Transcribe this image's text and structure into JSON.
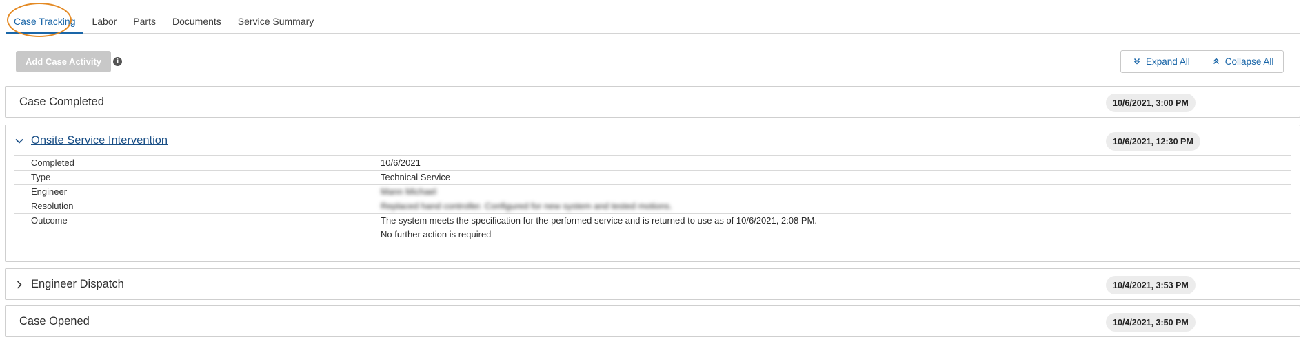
{
  "tabs": [
    {
      "label": "Case Tracking",
      "active": true
    },
    {
      "label": "Labor"
    },
    {
      "label": "Parts"
    },
    {
      "label": "Documents"
    },
    {
      "label": "Service Summary"
    }
  ],
  "actions": {
    "add_case_activity": "Add Case Activity",
    "info_icon": "i",
    "expand_all": "Expand All",
    "collapse_all": "Collapse All"
  },
  "cards": {
    "case_completed": {
      "title": "Case Completed",
      "timestamp": "10/6/2021, 3:00 PM"
    },
    "onsite": {
      "title": "Onsite Service Intervention",
      "timestamp": "10/6/2021, 12:30 PM",
      "expanded": true,
      "details": [
        {
          "key": "Completed",
          "value": "10/6/2021"
        },
        {
          "key": "Type",
          "value": "Technical Service"
        },
        {
          "key": "Engineer",
          "value": "Mann Michael"
        },
        {
          "key": "Resolution",
          "value": "Replaced hand controller. Configured for new system and tested motions."
        },
        {
          "key": "Outcome",
          "value": "The system meets the specification for the performed service and is returned to use as of 10/6/2021, 2:08 PM.",
          "value2": "No further action is required"
        }
      ]
    },
    "engineer_dispatch": {
      "title": "Engineer Dispatch",
      "timestamp": "10/4/2021, 3:53 PM"
    },
    "case_opened": {
      "title": "Case Opened",
      "timestamp": "10/4/2021, 3:50 PM"
    }
  },
  "colors": {
    "accent": "#1a66a8",
    "highlight": "#e48a24",
    "disabled_button": "#c8c8c8"
  },
  "icons": {
    "expand": "double-chevron-down-icon",
    "collapse": "double-chevron-up-icon",
    "expanded": "chevron-down-icon",
    "collapsed": "chevron-right-icon"
  }
}
